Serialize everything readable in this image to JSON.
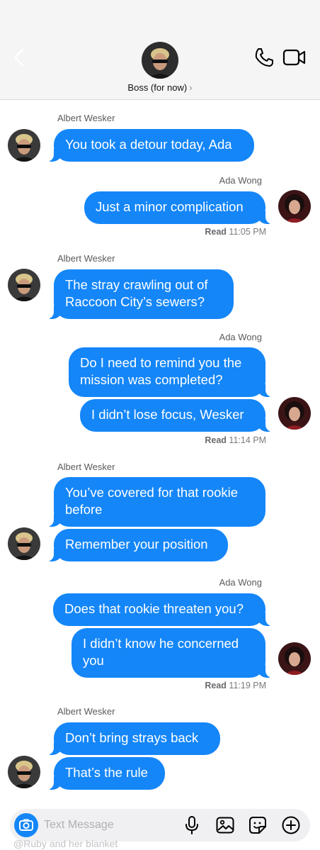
{
  "header": {
    "contact_name": "Boss (for now)",
    "chevron": "›",
    "icons": [
      "back-chevron-icon",
      "phone-icon",
      "video-camera-icon"
    ]
  },
  "colors": {
    "bubble": "#1486f8",
    "header_bg": "#f5f5f5",
    "text_secondary": "#5b5b5f"
  },
  "messages": [
    {
      "sender": "Albert Wesker",
      "texts": [
        "You took a detour today, Ada"
      ]
    },
    {
      "sender": "Ada Wong",
      "texts": [
        "Just a minor complication"
      ],
      "read_label": "Read",
      "read_time": "11:05 PM"
    },
    {
      "sender": "Albert Wesker",
      "texts": [
        "The stray crawling out of\nRaccoon City’s sewers?"
      ]
    },
    {
      "sender": "Ada Wong",
      "texts": [
        "Do I need to remind you the\nmission was completed?",
        "I didn’t lose focus, Wesker"
      ],
      "read_label": "Read",
      "read_time": "11:14 PM"
    },
    {
      "sender": "Albert Wesker",
      "texts": [
        "You’ve covered for that rookie\nbefore",
        "Remember your position"
      ]
    },
    {
      "sender": "Ada Wong",
      "texts": [
        "Does that rookie threaten you?",
        "I didn’t know he concerned\nyou"
      ],
      "read_label": "Read",
      "read_time": "11:19 PM"
    },
    {
      "sender": "Albert Wesker",
      "texts": [
        "Don’t bring strays back",
        "That’s the rule"
      ]
    }
  ],
  "composer": {
    "placeholder": "Text Message",
    "icons": [
      "camera-icon",
      "microphone-icon",
      "gallery-icon",
      "sticker-icon",
      "plus-icon"
    ]
  },
  "watermark": "@Ruby and her blanket"
}
